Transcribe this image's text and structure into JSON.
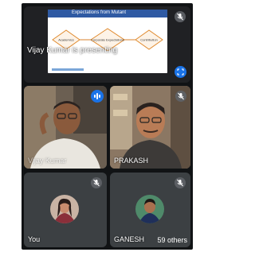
{
  "presentation": {
    "slide_title": "Expectations from Mutant",
    "slide_nodes": [
      "Academics",
      "Corporate Expectations",
      "Contribution"
    ],
    "presenter_label": "Vijay Kumar is presenting"
  },
  "participants": [
    {
      "name": "Vijay Kumar",
      "speaking": true
    },
    {
      "name": "PRAKASH"
    },
    {
      "name": "You"
    },
    {
      "name": "GANESH"
    }
  ],
  "others_label": "59 others",
  "colors": {
    "tile": "#3c4043",
    "accent": "#1a73e8",
    "frame": "#111315"
  }
}
